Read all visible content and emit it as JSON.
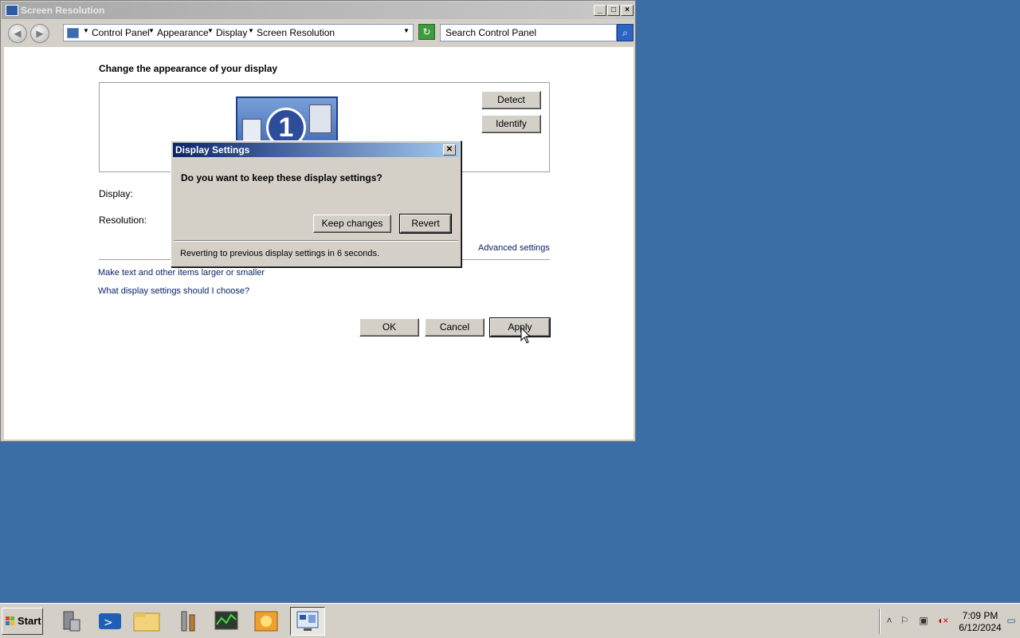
{
  "window": {
    "title": "Screen Resolution",
    "controls": {
      "minimize": "_",
      "maximize": "□",
      "close": "×"
    }
  },
  "addressbar": {
    "breadcrumbs": [
      "Control Panel",
      "Appearance",
      "Display",
      "Screen Resolution"
    ],
    "search_placeholder": "Search Control Panel"
  },
  "main": {
    "heading": "Change the appearance of your display",
    "monitor_number": "1",
    "detect_label": "Detect",
    "identify_label": "Identify",
    "display_label": "Display:",
    "resolution_label": "Resolution:",
    "advanced_link": "Advanced settings",
    "link_text_size": "Make text and other items larger or smaller",
    "link_help": "What display settings should I choose?",
    "ok_label": "OK",
    "cancel_label": "Cancel",
    "apply_label": "Apply"
  },
  "dialog": {
    "title": "Display Settings",
    "question": "Do you want to keep these display settings?",
    "keep_label": "Keep changes",
    "revert_label": "Revert",
    "status": "Reverting to previous display settings in 6 seconds."
  },
  "taskbar": {
    "start_label": "Start",
    "items": [
      "server-manager-icon",
      "powershell-icon",
      "explorer-icon",
      "tools-icon",
      "task-manager-icon",
      "media-icon",
      "control-panel-icon"
    ],
    "clock_time": "7:09 PM",
    "clock_date": "6/12/2024"
  },
  "colors": {
    "desktop": "#3a6ea5",
    "dialog_title": "#0a246a",
    "link": "#0a246a"
  }
}
